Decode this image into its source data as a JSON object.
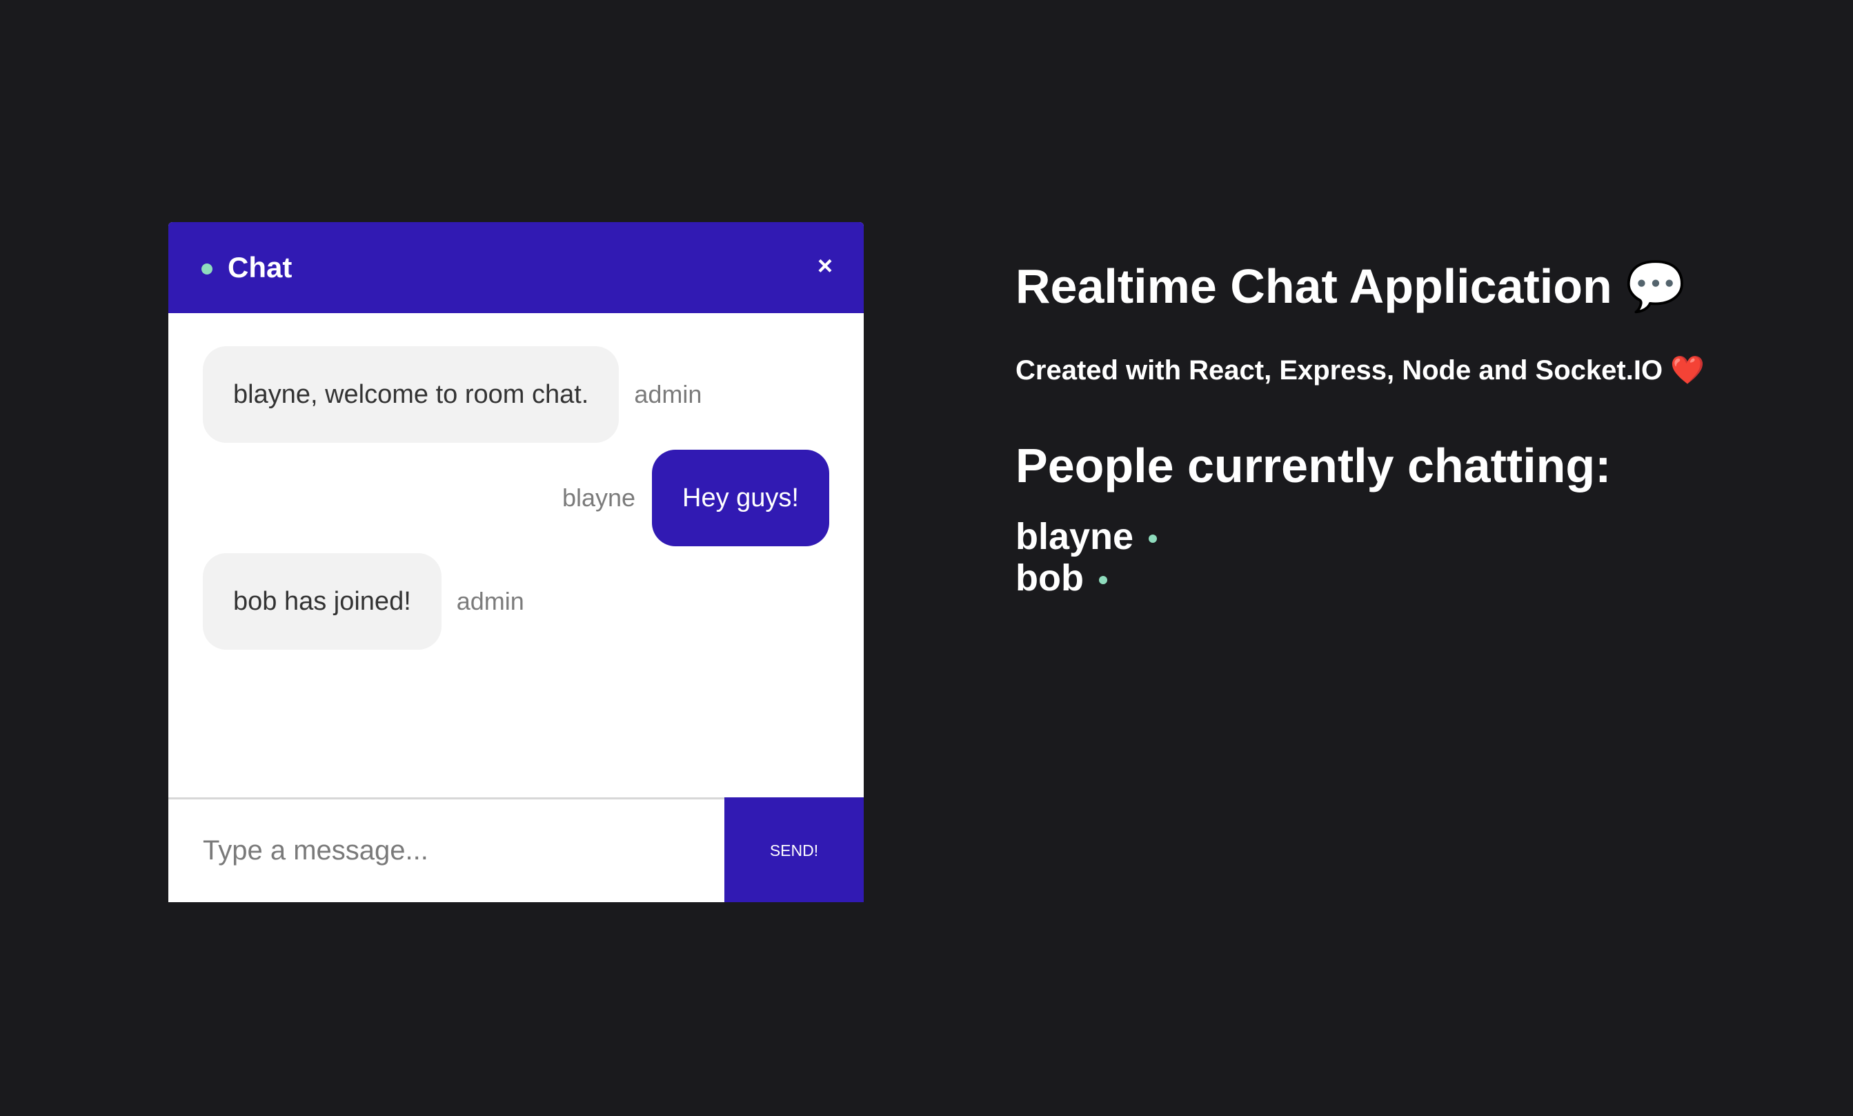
{
  "chat": {
    "title": "Chat",
    "close_icon": "×",
    "messages": [
      {
        "text": "blayne, welcome to room chat.",
        "sender": "admin",
        "mine": false
      },
      {
        "text": "Hey guys!",
        "sender": "blayne",
        "mine": true
      },
      {
        "text": "bob has joined!",
        "sender": "admin",
        "mine": false
      }
    ],
    "input": {
      "placeholder": "Type a message...",
      "value": ""
    },
    "send_label": "SEND!"
  },
  "info": {
    "title": "Realtime Chat Application",
    "title_icon": "💬",
    "subtitle": "Created with React, Express, Node and Socket.IO",
    "subtitle_icon": "❤️",
    "people_heading": "People currently chatting:",
    "people": [
      "blayne",
      "bob"
    ]
  },
  "colors": {
    "background": "#1a1a1d",
    "accent": "#311ab3",
    "online": "#8fdcbd"
  }
}
